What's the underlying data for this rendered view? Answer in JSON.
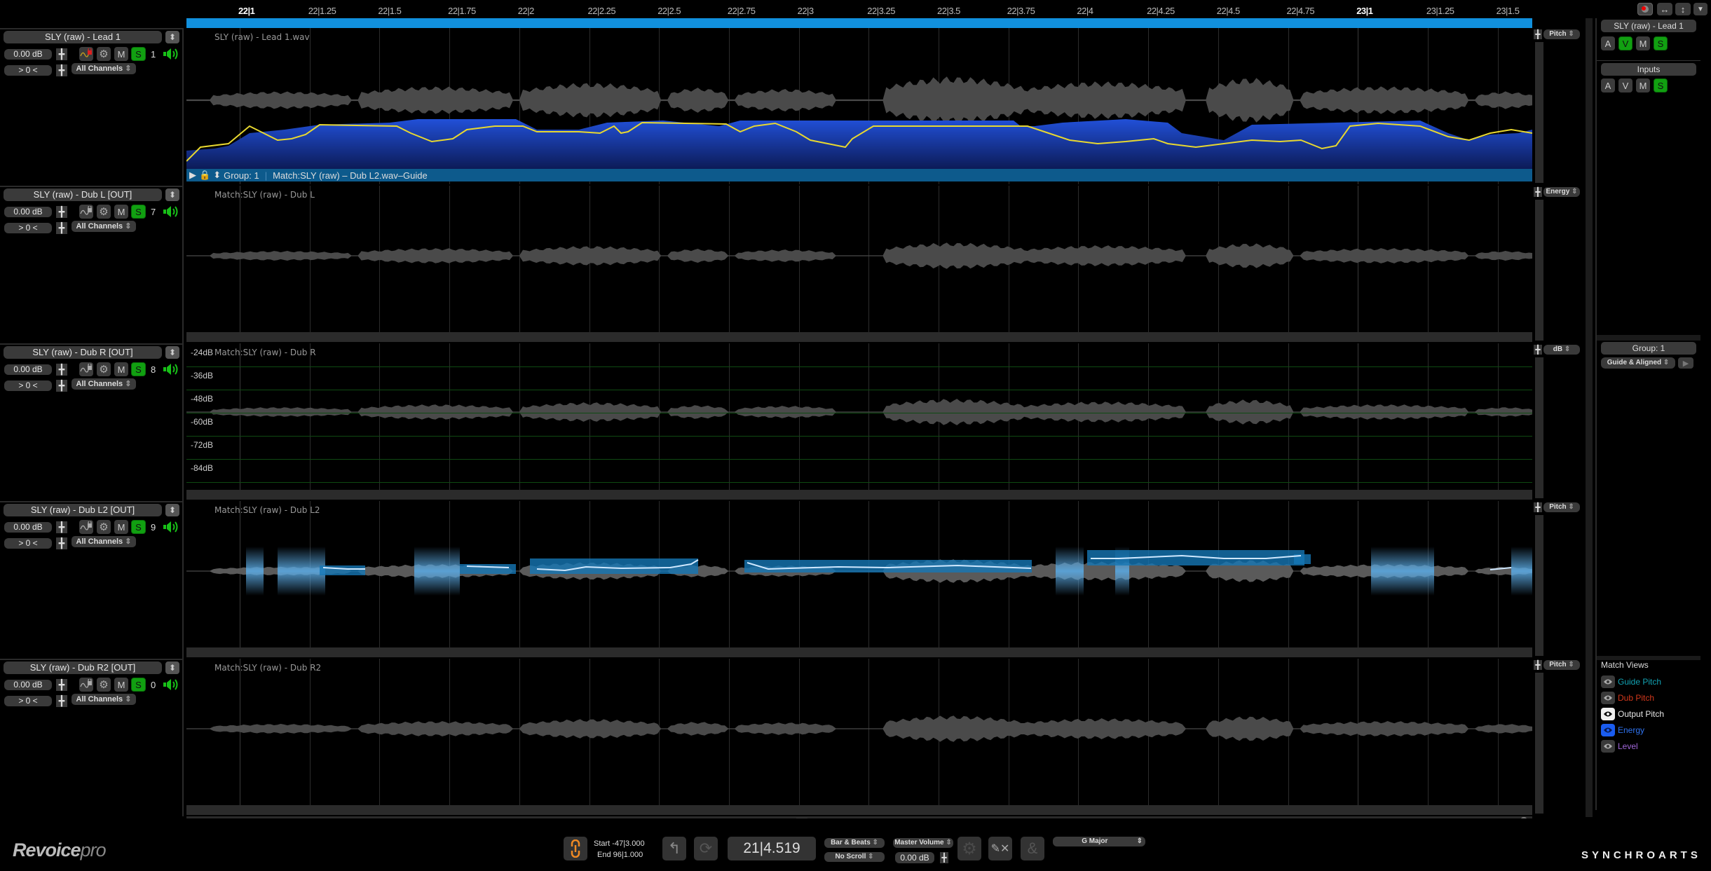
{
  "app": {
    "name": "Revoice",
    "name_suffix": "pro",
    "brand": "SYNCHROARTS"
  },
  "ruler": {
    "ticks": [
      {
        "label": "22|1",
        "bold": true
      },
      {
        "label": "22|1.25"
      },
      {
        "label": "22|1.5"
      },
      {
        "label": "22|1.75"
      },
      {
        "label": "22|2"
      },
      {
        "label": "22|2.25"
      },
      {
        "label": "22|2.5"
      },
      {
        "label": "22|2.75"
      },
      {
        "label": "22|3"
      },
      {
        "label": "22|3.25"
      },
      {
        "label": "22|3.5"
      },
      {
        "label": "22|3.75"
      },
      {
        "label": "22|4"
      },
      {
        "label": "22|4.25"
      },
      {
        "label": "22|4.5"
      },
      {
        "label": "22|4.75"
      },
      {
        "label": "23|1",
        "bold": true
      },
      {
        "label": "23|1.25"
      },
      {
        "label": "23|1.5"
      }
    ]
  },
  "tracks": [
    {
      "name": "SLY (raw) - Lead 1",
      "gain": "0.00 dB",
      "offset": "> 0 <",
      "channels": "All Channels",
      "mute": "M",
      "solo": "S",
      "number": "1",
      "locked": true,
      "lane_label": "SLY (raw) - Lead 1.wav",
      "view_mode": "Pitch",
      "group_bar": {
        "group": "Group: 1",
        "match": "Match:SLY (raw) – Dub L2.wav–Guide"
      }
    },
    {
      "name": "SLY (raw) - Dub L  [OUT]",
      "gain": "0.00 dB",
      "offset": "> 0 <",
      "channels": "All Channels",
      "mute": "M",
      "solo": "S",
      "number": "7",
      "locked": false,
      "lane_label": "Match:SLY (raw) - Dub L",
      "view_mode": "Energy"
    },
    {
      "name": "SLY (raw) - Dub R  [OUT]",
      "gain": "0.00 dB",
      "offset": "> 0 <",
      "channels": "All Channels",
      "mute": "M",
      "solo": "S",
      "number": "8",
      "locked": false,
      "lane_label": "Match:SLY (raw) - Dub R",
      "view_mode": "dB",
      "db_scale": [
        "-24dB",
        "-36dB",
        "-48dB",
        "-60dB",
        "-72dB",
        "-84dB"
      ]
    },
    {
      "name": "SLY (raw) - Dub L2  [OUT]",
      "gain": "0.00 dB",
      "offset": "> 0 <",
      "channels": "All Channels",
      "mute": "M",
      "solo": "S",
      "number": "9",
      "locked": false,
      "lane_label": "Match:SLY (raw) - Dub L2",
      "view_mode": "Pitch"
    },
    {
      "name": "SLY (raw) - Dub R2  [OUT]",
      "gain": "0.00 dB",
      "offset": "> 0 <",
      "channels": "All Channels",
      "mute": "M",
      "solo": "S",
      "number": "0",
      "locked": false,
      "lane_label": "Match:SLY (raw) - Dub R2",
      "view_mode": "Pitch"
    }
  ],
  "right_panel": {
    "selected_track": "SLY (raw) - Lead 1",
    "track_buttons": [
      "A",
      "V",
      "M",
      "S"
    ],
    "inputs_title": "Inputs",
    "inputs_buttons": [
      "A",
      "V",
      "M",
      "S"
    ],
    "group_title": "Group: 1",
    "group_mode": "Guide & Aligned",
    "match_views_title": "Match Views",
    "match_views": [
      {
        "label": "Guide Pitch",
        "color": "#12a3b3",
        "eye_style": "normal"
      },
      {
        "label": "Dub Pitch",
        "color": "#d3381c",
        "eye_style": "normal"
      },
      {
        "label": "Output Pitch",
        "color": "#e6e6e6",
        "eye_style": "white"
      },
      {
        "label": "Energy",
        "color": "#2f73f0",
        "eye_style": "blue"
      },
      {
        "label": "Level",
        "color": "#a066d8",
        "eye_style": "normal"
      }
    ]
  },
  "toolbar": {
    "start_label": "Start",
    "start_value": "-47|3.000",
    "end_label": "End",
    "end_value": "96|1.000",
    "position": "21|4.519",
    "time_format": "Bar & Beats",
    "scroll_mode": "No Scroll",
    "master_label": "Master Volume",
    "master_value": "0.00 dB",
    "key": "G Major"
  },
  "colors": {
    "accent_blue": "#1190dd",
    "solo_green": "#11a011",
    "energy_blue": "#1e47c8",
    "pitch_yellow": "#e8d830",
    "group_bar": "#0d5a8c",
    "waveform_grey": "#4a4a4a"
  }
}
